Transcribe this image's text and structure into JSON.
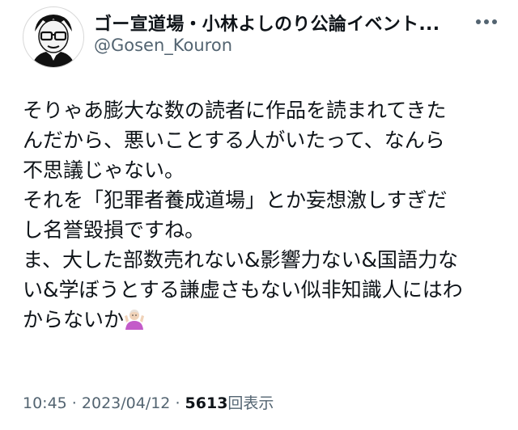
{
  "author": {
    "display_name": "ゴー宣道場・小林よしのり公論イベント...",
    "handle": "@Gosen_Kouron",
    "avatar_icon": "caricature-avatar-icon",
    "more_icon": "more-options-icon"
  },
  "tweet": {
    "lines": [
      "そりゃあ膨大な数の読者に作品を読まれてきた",
      "んだから、悪いことする人がいたって、なんら",
      "不思議じゃない。",
      "それを「犯罪者養成道場」とか妄想激しすぎだ",
      "し名誉毀損ですね。",
      "ま、大した部数売れない&影響力ない&国語力な",
      "い&学ぼうとする謙虚さもない似非知識人にはわ",
      "からないか"
    ],
    "trailing_emoji": "person-shrugging-emoji"
  },
  "meta": {
    "time": "10:45",
    "separator": " · ",
    "date": "2023/04/12",
    "views_count": "5613",
    "views_label": "回表示"
  },
  "colors": {
    "text": "#0f1419",
    "secondary": "#536471",
    "emoji_shirt": "#c35bc9",
    "emoji_skin": "#f0d2b8"
  }
}
